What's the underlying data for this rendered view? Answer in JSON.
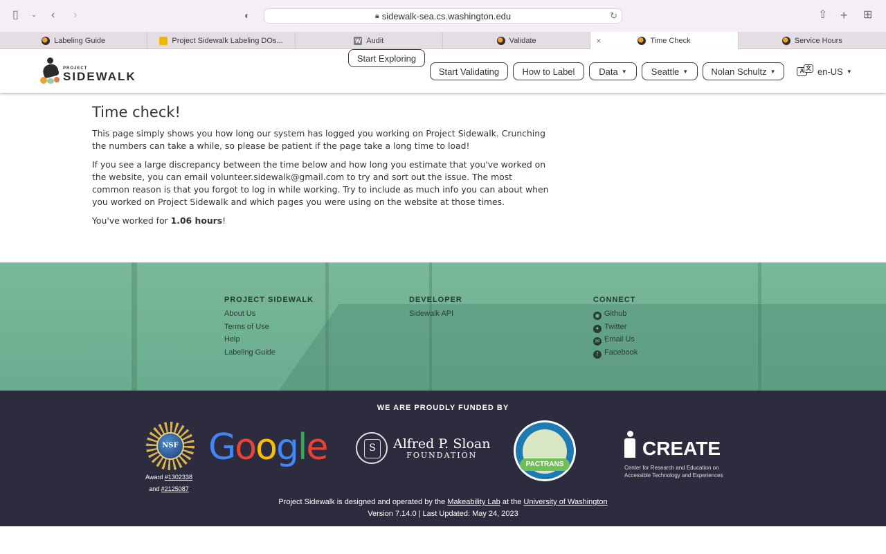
{
  "browser": {
    "url": "sidewalk-sea.cs.washington.edu",
    "tabs": [
      {
        "label": "Labeling Guide",
        "favicon": "project-sidewalk-icon"
      },
      {
        "label": "Project Sidewalk Labeling DOs...",
        "favicon": "google-slides-icon"
      },
      {
        "label": "Audit",
        "favicon": "w-icon"
      },
      {
        "label": "Validate",
        "favicon": "project-sidewalk-icon"
      },
      {
        "label": "Time Check",
        "favicon": "project-sidewalk-icon"
      },
      {
        "label": "Service Hours",
        "favicon": "project-sidewalk-icon"
      }
    ]
  },
  "header": {
    "logo_small": "PROJECT",
    "logo_big": "SIDEWALK",
    "nav": {
      "start_exploring": "Start Exploring",
      "start_validating": "Start Validating",
      "how_to_label": "How to Label",
      "data": "Data",
      "city": "Seattle",
      "user": "Nolan Schultz"
    },
    "language": "en-US",
    "language_icon_a": "A",
    "language_icon_b": "文"
  },
  "main": {
    "title": "Time check!",
    "para1": "This page simply shows you how long our system has logged you working on Project Sidewalk. Crunching the numbers can take a while, so please be patient if the page take a long time to load!",
    "para2": "If you see a large discrepancy between the time below and how long you estimate that you've worked on the website, you can email volunteer.sidewalk@gmail.com to try and sort out the issue. The most common reason is that you forgot to log in while working. Try to include as much info you can about when you worked on Project Sidewalk and which pages you were using on the website at those times.",
    "worked_prefix": "You've worked for ",
    "worked_hours": "1.06 hours",
    "worked_suffix": "!"
  },
  "footer": {
    "col1": {
      "title": "PROJECT SIDEWALK",
      "links": [
        "About Us",
        "Terms of Use",
        "Help",
        "Labeling Guide"
      ]
    },
    "col2": {
      "title": "DEVELOPER",
      "links": [
        "Sidewalk API"
      ]
    },
    "col3": {
      "title": "CONNECT",
      "links": [
        {
          "label": "Github",
          "icon": "github-icon"
        },
        {
          "label": "Twitter",
          "icon": "twitter-icon"
        },
        {
          "label": "Email Us",
          "icon": "email-icon"
        },
        {
          "label": "Facebook",
          "icon": "facebook-icon"
        }
      ]
    }
  },
  "funded": {
    "title": "WE ARE PROUDLY FUNDED BY",
    "nsf_text": "NSF",
    "award_prefix": "Award ",
    "award1": "#1302338",
    "award_and": "and ",
    "award2": "#2125087",
    "google": [
      "G",
      "o",
      "o",
      "g",
      "l",
      "e"
    ],
    "google_colors": [
      "#4285F4",
      "#EA4335",
      "#FBBC05",
      "#4285F4",
      "#34A853",
      "#EA4335"
    ],
    "sloan_line1": "Alfred P. Sloan",
    "sloan_line2": "FOUNDATION",
    "pactrans_label": "PACTRANS",
    "create_word": "CREATE",
    "create_sub": "Center for Research and Education on Accessible Technology and Experiences",
    "credits_prefix": "Project Sidewalk is designed and operated by the ",
    "credits_lab": "Makeability Lab",
    "credits_mid": " at the ",
    "credits_uw": "University of Washington",
    "version": "Version 7.14.0 | Last Updated: May 24, 2023"
  }
}
